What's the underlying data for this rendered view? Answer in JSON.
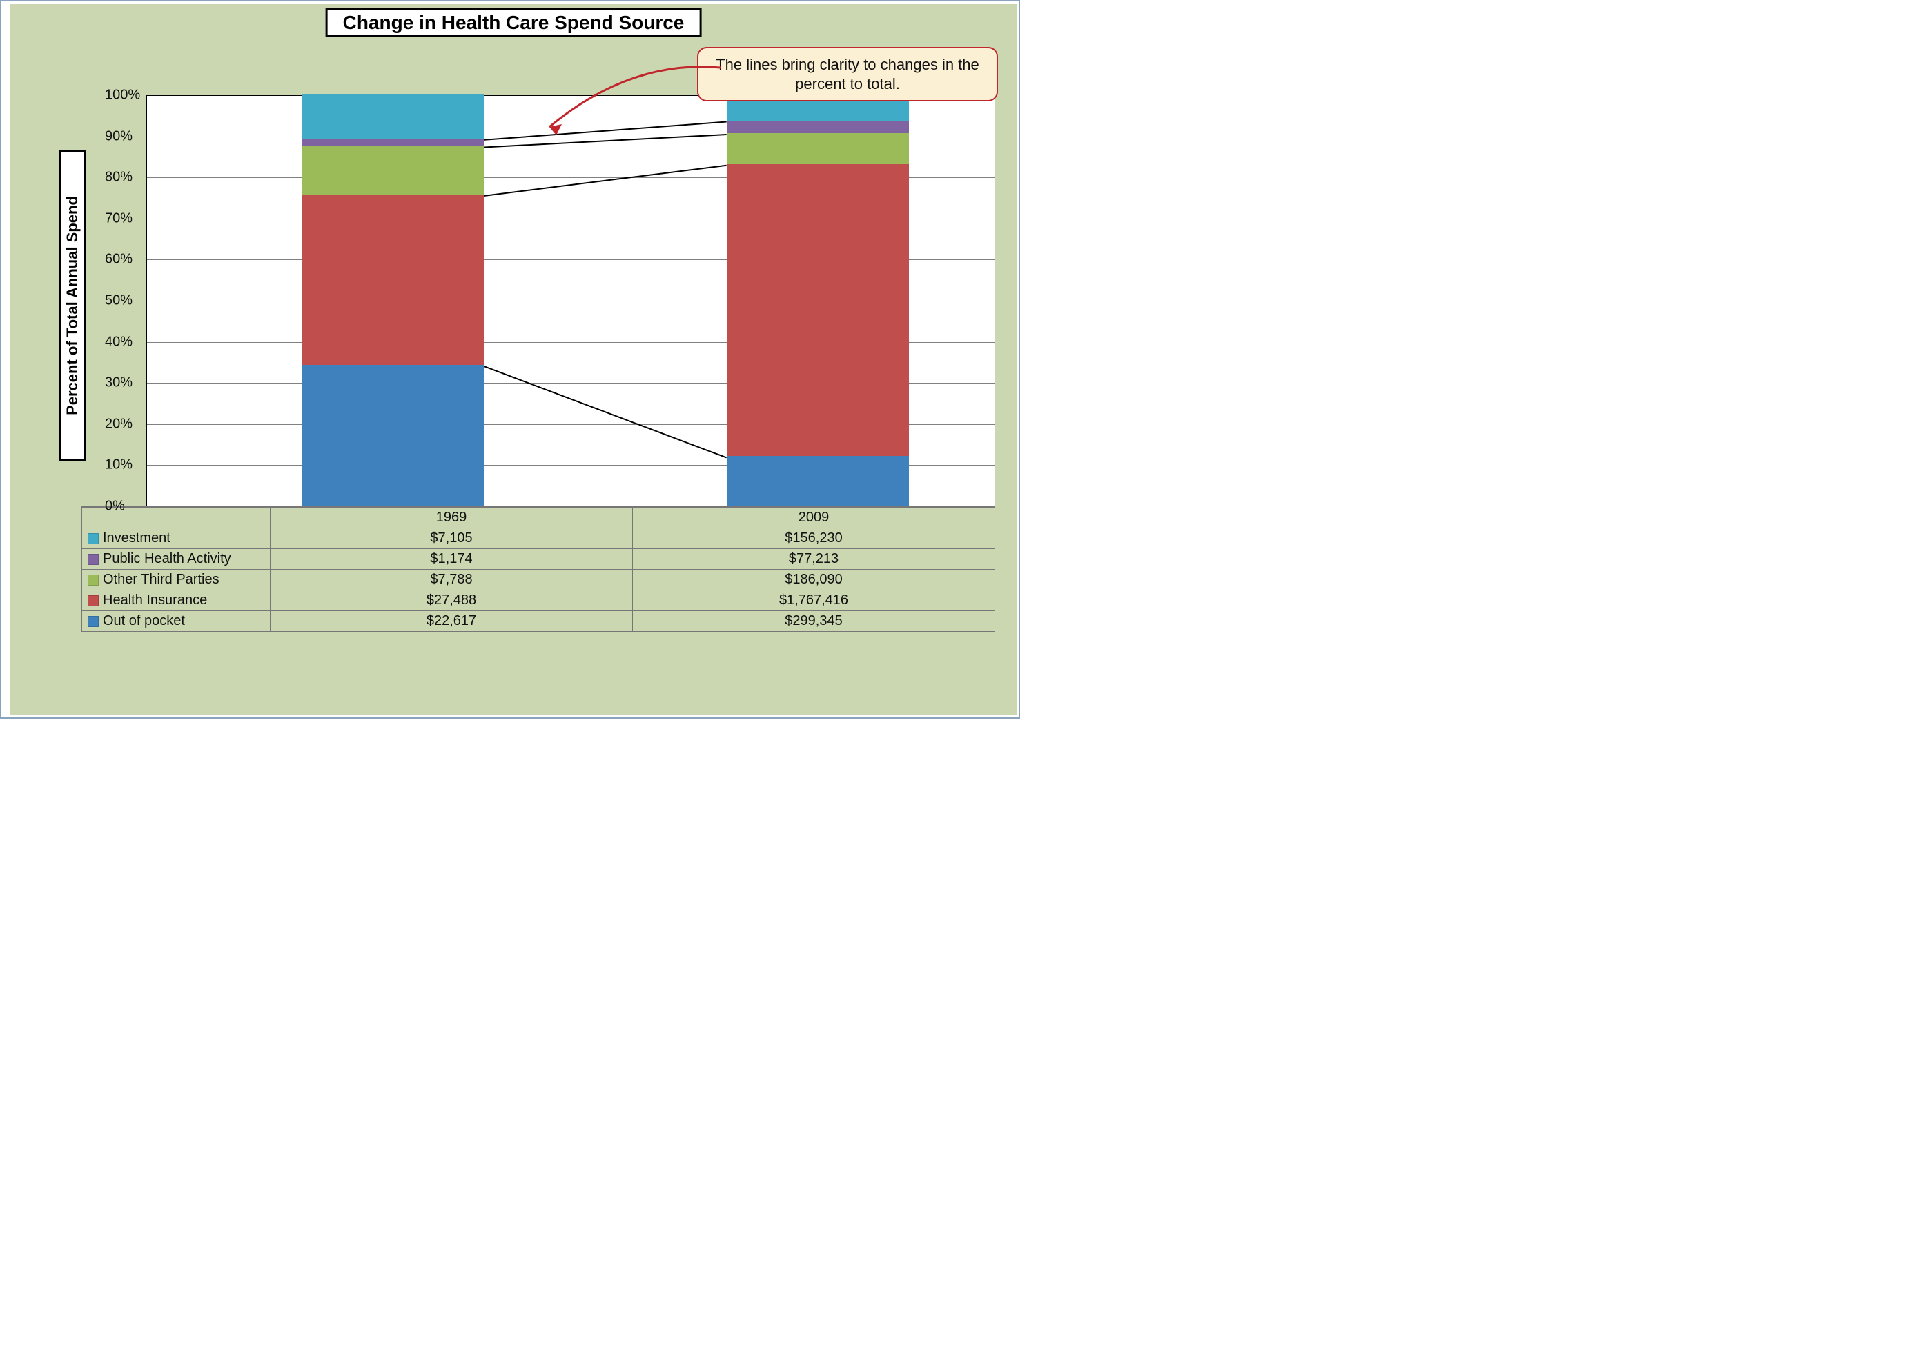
{
  "title": "Change in Health Care Spend Source",
  "ylabel": "Percent of Total Annual Spend",
  "callout": "The lines bring clarity to changes in the percent to total.",
  "categories": [
    "1969",
    "2009"
  ],
  "yticks": [
    "0%",
    "10%",
    "20%",
    "30%",
    "40%",
    "50%",
    "60%",
    "70%",
    "80%",
    "90%",
    "100%"
  ],
  "legend_rows": [
    {
      "key": "inv",
      "name": "Investment",
      "color": "#3fabc6"
    },
    {
      "key": "pha",
      "name": "Public Health Activity",
      "color": "#8064a2"
    },
    {
      "key": "otp",
      "name": "Other Third Parties",
      "color": "#9bba58"
    },
    {
      "key": "hi",
      "name": "Health Insurance",
      "color": "#bf4e4c"
    },
    {
      "key": "oop",
      "name": "Out of pocket",
      "color": "#3f81bd"
    }
  ],
  "table": {
    "inv": [
      "$7,105",
      "$156,230"
    ],
    "pha": [
      "$1,174",
      "$77,213"
    ],
    "otp": [
      "$7,788",
      "$186,090"
    ],
    "hi": [
      "$27,488",
      "$1,767,416"
    ],
    "oop": [
      "$22,617",
      "$299,345"
    ]
  },
  "chart_data": {
    "type": "bar",
    "stacked": true,
    "normalized_percent": true,
    "title": "Change in Health Care Spend Source",
    "ylabel": "Percent of Total Annual Spend",
    "ylim": [
      0,
      100
    ],
    "categories": [
      "1969",
      "2009"
    ],
    "series": [
      {
        "name": "Out of pocket",
        "key": "oop",
        "color": "#3f81bd",
        "values": [
          22617,
          299345
        ],
        "percent": [
          34.2,
          12.0
        ]
      },
      {
        "name": "Health Insurance",
        "key": "hi",
        "color": "#bf4e4c",
        "values": [
          27488,
          1767416
        ],
        "percent": [
          41.5,
          71.1
        ]
      },
      {
        "name": "Other Third Parties",
        "key": "otp",
        "color": "#9bba58",
        "values": [
          7788,
          186090
        ],
        "percent": [
          11.8,
          7.5
        ]
      },
      {
        "name": "Public Health Activity",
        "key": "pha",
        "color": "#8064a2",
        "values": [
          1174,
          77213
        ],
        "percent": [
          1.8,
          3.1
        ]
      },
      {
        "name": "Investment",
        "key": "inv",
        "color": "#3fabc6",
        "values": [
          7105,
          156230
        ],
        "percent": [
          10.7,
          6.3
        ]
      }
    ],
    "annotations": [
      {
        "text": "The lines bring clarity to changes in the percent to total."
      }
    ]
  }
}
